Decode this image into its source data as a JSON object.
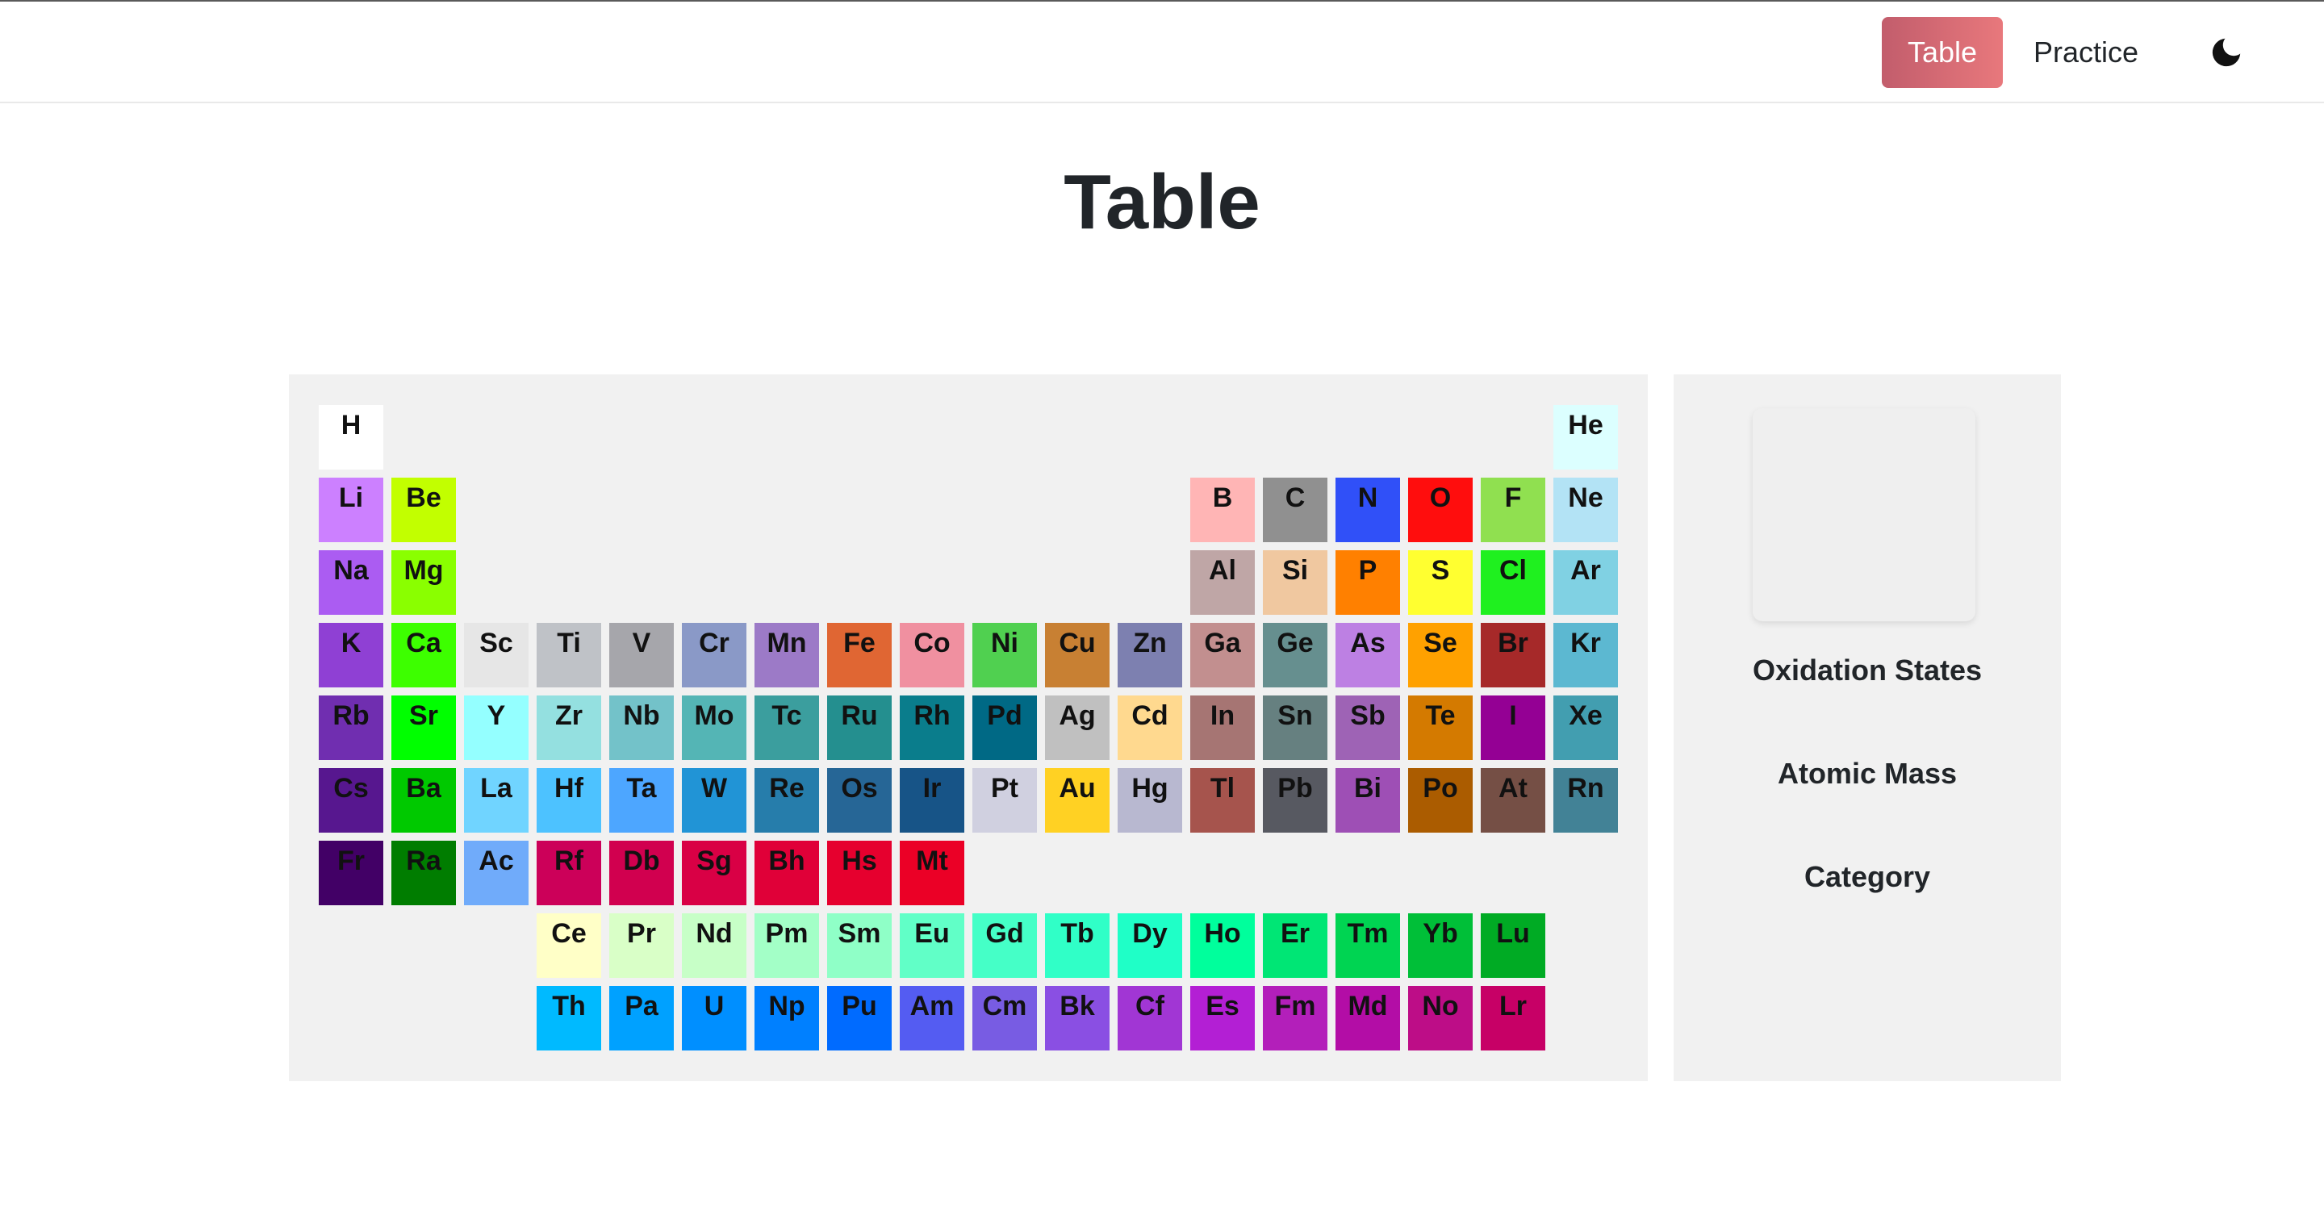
{
  "nav": {
    "table_label": "Table",
    "practice_label": "Practice",
    "theme_icon": "moon-icon",
    "active_color": "#d96b74"
  },
  "page": {
    "title": "Table"
  },
  "details": {
    "oxidation_label": "Oxidation States",
    "mass_label": "Atomic Mass",
    "category_label": "Category"
  },
  "elements": [
    {
      "symbol": "H",
      "row": 1,
      "col": 1,
      "color": "#ffffff"
    },
    {
      "symbol": "He",
      "row": 1,
      "col": 18,
      "color": "#dcffff"
    },
    {
      "symbol": "Li",
      "row": 2,
      "col": 1,
      "color": "#cc80ff"
    },
    {
      "symbol": "Be",
      "row": 2,
      "col": 2,
      "color": "#c2ff00"
    },
    {
      "symbol": "B",
      "row": 2,
      "col": 13,
      "color": "#ffb5b5"
    },
    {
      "symbol": "C",
      "row": 2,
      "col": 14,
      "color": "#909090"
    },
    {
      "symbol": "N",
      "row": 2,
      "col": 15,
      "color": "#3050f8"
    },
    {
      "symbol": "O",
      "row": 2,
      "col": 16,
      "color": "#ff0d0d"
    },
    {
      "symbol": "F",
      "row": 2,
      "col": 17,
      "color": "#90e050"
    },
    {
      "symbol": "Ne",
      "row": 2,
      "col": 18,
      "color": "#b3e3f5"
    },
    {
      "symbol": "Na",
      "row": 3,
      "col": 1,
      "color": "#ab5cf2"
    },
    {
      "symbol": "Mg",
      "row": 3,
      "col": 2,
      "color": "#8aff00"
    },
    {
      "symbol": "Al",
      "row": 3,
      "col": 13,
      "color": "#bfa6a6"
    },
    {
      "symbol": "Si",
      "row": 3,
      "col": 14,
      "color": "#f0c8a0"
    },
    {
      "symbol": "P",
      "row": 3,
      "col": 15,
      "color": "#ff8000"
    },
    {
      "symbol": "S",
      "row": 3,
      "col": 16,
      "color": "#ffff30"
    },
    {
      "symbol": "Cl",
      "row": 3,
      "col": 17,
      "color": "#1ff01f"
    },
    {
      "symbol": "Ar",
      "row": 3,
      "col": 18,
      "color": "#80d1e3"
    },
    {
      "symbol": "K",
      "row": 4,
      "col": 1,
      "color": "#8f40d4"
    },
    {
      "symbol": "Ca",
      "row": 4,
      "col": 2,
      "color": "#3dff00"
    },
    {
      "symbol": "Sc",
      "row": 4,
      "col": 3,
      "color": "#e6e6e6"
    },
    {
      "symbol": "Ti",
      "row": 4,
      "col": 4,
      "color": "#bfc2c7"
    },
    {
      "symbol": "V",
      "row": 4,
      "col": 5,
      "color": "#a6a6ab"
    },
    {
      "symbol": "Cr",
      "row": 4,
      "col": 6,
      "color": "#8a99c7"
    },
    {
      "symbol": "Mn",
      "row": 4,
      "col": 7,
      "color": "#9c7ac7"
    },
    {
      "symbol": "Fe",
      "row": 4,
      "col": 8,
      "color": "#e06633"
    },
    {
      "symbol": "Co",
      "row": 4,
      "col": 9,
      "color": "#f090a0"
    },
    {
      "symbol": "Ni",
      "row": 4,
      "col": 10,
      "color": "#50d050"
    },
    {
      "symbol": "Cu",
      "row": 4,
      "col": 11,
      "color": "#c88033"
    },
    {
      "symbol": "Zn",
      "row": 4,
      "col": 12,
      "color": "#7d80b0"
    },
    {
      "symbol": "Ga",
      "row": 4,
      "col": 13,
      "color": "#c28f8f"
    },
    {
      "symbol": "Ge",
      "row": 4,
      "col": 14,
      "color": "#668f8f"
    },
    {
      "symbol": "As",
      "row": 4,
      "col": 15,
      "color": "#bd80e3"
    },
    {
      "symbol": "Se",
      "row": 4,
      "col": 16,
      "color": "#ffa100"
    },
    {
      "symbol": "Br",
      "row": 4,
      "col": 17,
      "color": "#a62929"
    },
    {
      "symbol": "Kr",
      "row": 4,
      "col": 18,
      "color": "#5cb8d1"
    },
    {
      "symbol": "Rb",
      "row": 5,
      "col": 1,
      "color": "#702eb0"
    },
    {
      "symbol": "Sr",
      "row": 5,
      "col": 2,
      "color": "#00ff00"
    },
    {
      "symbol": "Y",
      "row": 5,
      "col": 3,
      "color": "#94ffff"
    },
    {
      "symbol": "Zr",
      "row": 5,
      "col": 4,
      "color": "#94e0e0"
    },
    {
      "symbol": "Nb",
      "row": 5,
      "col": 5,
      "color": "#73c2c9"
    },
    {
      "symbol": "Mo",
      "row": 5,
      "col": 6,
      "color": "#54b5b5"
    },
    {
      "symbol": "Tc",
      "row": 5,
      "col": 7,
      "color": "#3b9e9e"
    },
    {
      "symbol": "Ru",
      "row": 5,
      "col": 8,
      "color": "#248f8f"
    },
    {
      "symbol": "Rh",
      "row": 5,
      "col": 9,
      "color": "#0a7d8c"
    },
    {
      "symbol": "Pd",
      "row": 5,
      "col": 10,
      "color": "#006985"
    },
    {
      "symbol": "Ag",
      "row": 5,
      "col": 11,
      "color": "#c0c0c0"
    },
    {
      "symbol": "Cd",
      "row": 5,
      "col": 12,
      "color": "#ffd98f"
    },
    {
      "symbol": "In",
      "row": 5,
      "col": 13,
      "color": "#a67573"
    },
    {
      "symbol": "Sn",
      "row": 5,
      "col": 14,
      "color": "#668080"
    },
    {
      "symbol": "Sb",
      "row": 5,
      "col": 15,
      "color": "#9e63b5"
    },
    {
      "symbol": "Te",
      "row": 5,
      "col": 16,
      "color": "#d47a00"
    },
    {
      "symbol": "I",
      "row": 5,
      "col": 17,
      "color": "#940094"
    },
    {
      "symbol": "Xe",
      "row": 5,
      "col": 18,
      "color": "#429eb0"
    },
    {
      "symbol": "Cs",
      "row": 6,
      "col": 1,
      "color": "#57178f"
    },
    {
      "symbol": "Ba",
      "row": 6,
      "col": 2,
      "color": "#00c900"
    },
    {
      "symbol": "La",
      "row": 6,
      "col": 3,
      "color": "#70d4ff"
    },
    {
      "symbol": "Hf",
      "row": 6,
      "col": 4,
      "color": "#4dc2ff"
    },
    {
      "symbol": "Ta",
      "row": 6,
      "col": 5,
      "color": "#4da6ff"
    },
    {
      "symbol": "W",
      "row": 6,
      "col": 6,
      "color": "#2194d6"
    },
    {
      "symbol": "Re",
      "row": 6,
      "col": 7,
      "color": "#267dab"
    },
    {
      "symbol": "Os",
      "row": 6,
      "col": 8,
      "color": "#266696"
    },
    {
      "symbol": "Ir",
      "row": 6,
      "col": 9,
      "color": "#175487"
    },
    {
      "symbol": "Pt",
      "row": 6,
      "col": 10,
      "color": "#d0d0e0"
    },
    {
      "symbol": "Au",
      "row": 6,
      "col": 11,
      "color": "#ffd123"
    },
    {
      "symbol": "Hg",
      "row": 6,
      "col": 12,
      "color": "#b8b8d0"
    },
    {
      "symbol": "Tl",
      "row": 6,
      "col": 13,
      "color": "#a6544d"
    },
    {
      "symbol": "Pb",
      "row": 6,
      "col": 14,
      "color": "#575961"
    },
    {
      "symbol": "Bi",
      "row": 6,
      "col": 15,
      "color": "#9e4fb5"
    },
    {
      "symbol": "Po",
      "row": 6,
      "col": 16,
      "color": "#ab5c00"
    },
    {
      "symbol": "At",
      "row": 6,
      "col": 17,
      "color": "#754f45"
    },
    {
      "symbol": "Rn",
      "row": 6,
      "col": 18,
      "color": "#428296"
    },
    {
      "symbol": "Fr",
      "row": 7,
      "col": 1,
      "color": "#420066"
    },
    {
      "symbol": "Ra",
      "row": 7,
      "col": 2,
      "color": "#007d00"
    },
    {
      "symbol": "Ac",
      "row": 7,
      "col": 3,
      "color": "#70abfa"
    },
    {
      "symbol": "Rf",
      "row": 7,
      "col": 4,
      "color": "#cc0059"
    },
    {
      "symbol": "Db",
      "row": 7,
      "col": 5,
      "color": "#d1004f"
    },
    {
      "symbol": "Sg",
      "row": 7,
      "col": 6,
      "color": "#d90045"
    },
    {
      "symbol": "Bh",
      "row": 7,
      "col": 7,
      "color": "#e00038"
    },
    {
      "symbol": "Hs",
      "row": 7,
      "col": 8,
      "color": "#e6002e"
    },
    {
      "symbol": "Mt",
      "row": 7,
      "col": 9,
      "color": "#eb0026"
    },
    {
      "symbol": "Ce",
      "row": 8,
      "col": 4,
      "color": "#ffffc7"
    },
    {
      "symbol": "Pr",
      "row": 8,
      "col": 5,
      "color": "#d9ffc7"
    },
    {
      "symbol": "Nd",
      "row": 8,
      "col": 6,
      "color": "#c7ffc7"
    },
    {
      "symbol": "Pm",
      "row": 8,
      "col": 7,
      "color": "#a3ffc7"
    },
    {
      "symbol": "Sm",
      "row": 8,
      "col": 8,
      "color": "#8fffc7"
    },
    {
      "symbol": "Eu",
      "row": 8,
      "col": 9,
      "color": "#61ffc7"
    },
    {
      "symbol": "Gd",
      "row": 8,
      "col": 10,
      "color": "#45ffc7"
    },
    {
      "symbol": "Tb",
      "row": 8,
      "col": 11,
      "color": "#30ffc7"
    },
    {
      "symbol": "Dy",
      "row": 8,
      "col": 12,
      "color": "#1fffc7"
    },
    {
      "symbol": "Ho",
      "row": 8,
      "col": 13,
      "color": "#00ff9c"
    },
    {
      "symbol": "Er",
      "row": 8,
      "col": 14,
      "color": "#00e675"
    },
    {
      "symbol": "Tm",
      "row": 8,
      "col": 15,
      "color": "#00d452"
    },
    {
      "symbol": "Yb",
      "row": 8,
      "col": 16,
      "color": "#00bf38"
    },
    {
      "symbol": "Lu",
      "row": 8,
      "col": 17,
      "color": "#00ab24"
    },
    {
      "symbol": "Th",
      "row": 9,
      "col": 4,
      "color": "#00baff"
    },
    {
      "symbol": "Pa",
      "row": 9,
      "col": 5,
      "color": "#00a1ff"
    },
    {
      "symbol": "U",
      "row": 9,
      "col": 6,
      "color": "#008fff"
    },
    {
      "symbol": "Np",
      "row": 9,
      "col": 7,
      "color": "#0080ff"
    },
    {
      "symbol": "Pu",
      "row": 9,
      "col": 8,
      "color": "#006bff"
    },
    {
      "symbol": "Am",
      "row": 9,
      "col": 9,
      "color": "#545cf2"
    },
    {
      "symbol": "Cm",
      "row": 9,
      "col": 10,
      "color": "#785ce3"
    },
    {
      "symbol": "Bk",
      "row": 9,
      "col": 11,
      "color": "#8a4fe3"
    },
    {
      "symbol": "Cf",
      "row": 9,
      "col": 12,
      "color": "#a136d4"
    },
    {
      "symbol": "Es",
      "row": 9,
      "col": 13,
      "color": "#b31fd4"
    },
    {
      "symbol": "Fm",
      "row": 9,
      "col": 14,
      "color": "#b31fba"
    },
    {
      "symbol": "Md",
      "row": 9,
      "col": 15,
      "color": "#b30da6"
    },
    {
      "symbol": "No",
      "row": 9,
      "col": 16,
      "color": "#bd0d87"
    },
    {
      "symbol": "Lr",
      "row": 9,
      "col": 17,
      "color": "#c70066"
    }
  ]
}
